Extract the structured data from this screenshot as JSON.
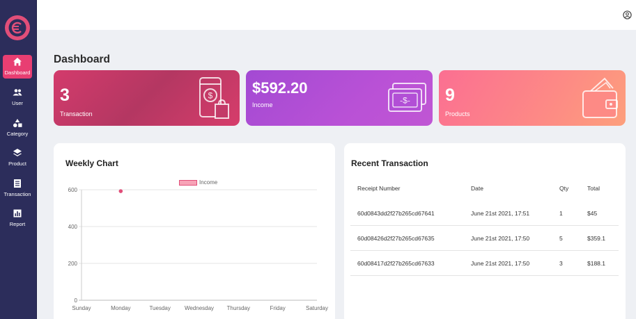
{
  "sidebar": {
    "items": [
      {
        "label": "Dashboard",
        "icon": "home-icon"
      },
      {
        "label": "User",
        "icon": "users-icon"
      },
      {
        "label": "Category",
        "icon": "category-icon"
      },
      {
        "label": "Product",
        "icon": "layers-icon"
      },
      {
        "label": "Transaction",
        "icon": "list-icon"
      },
      {
        "label": "Report",
        "icon": "bar-chart-icon"
      }
    ]
  },
  "header": {
    "user_icon": "user-circle-icon"
  },
  "page": {
    "title": "Dashboard"
  },
  "stats": [
    {
      "value": "3",
      "label": "Transaction",
      "icon": "phone-dollar-bag-icon"
    },
    {
      "value": "$592.20",
      "label": "Income",
      "icon": "money-bill-icon"
    },
    {
      "value": "9",
      "label": "Products",
      "icon": "wallet-icon"
    }
  ],
  "colors": {
    "sidebar": "#2c2d5b",
    "accent": "#e83e72",
    "card1": "#d43a6e",
    "card2": "#b24fd6",
    "card3": "#fd7f8c"
  },
  "weekly_chart": {
    "title": "Weekly Chart",
    "legend": "Income"
  },
  "chart_data": {
    "type": "line",
    "title": "Weekly Chart",
    "categories": [
      "Sunday",
      "Monday",
      "Tuesday",
      "Wednesday",
      "Thursday",
      "Friday",
      "Saturday"
    ],
    "series": [
      {
        "name": "Income",
        "values": [
          null,
          592.2,
          null,
          null,
          null,
          null,
          null
        ],
        "color": "#e14e79"
      }
    ],
    "y_ticks": [
      0,
      200,
      400,
      600
    ],
    "ylim": [
      0,
      600
    ],
    "grid": true,
    "legend_position": "top"
  },
  "recent": {
    "title": "Recent Transaction",
    "columns": [
      "Receipt Number",
      "Date",
      "Qty",
      "Total"
    ],
    "rows": [
      [
        "60d0843dd2f27b265cd67641",
        "June 21st 2021, 17:51",
        "1",
        "$45"
      ],
      [
        "60d08426d2f27b265cd67635",
        "June 21st 2021, 17:50",
        "5",
        "$359.1"
      ],
      [
        "60d08417d2f27b265cd67633",
        "June 21st 2021, 17:50",
        "3",
        "$188.1"
      ]
    ]
  }
}
